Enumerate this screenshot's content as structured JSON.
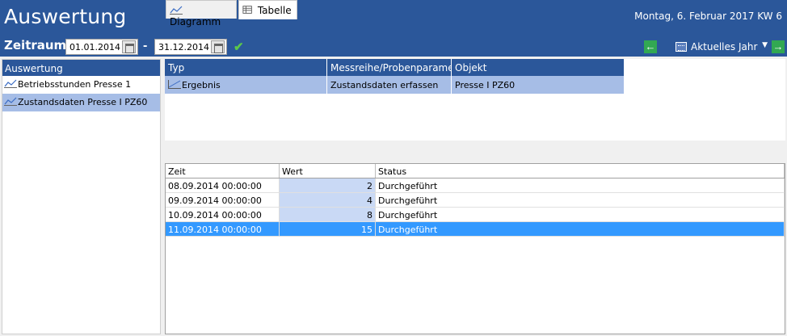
{
  "header": {
    "title": "Auswertung",
    "date_display": "Montag, 6. Februar 2017  KW 6",
    "zeitraum_label": "Zeitraum",
    "date_from": "01.01.2014",
    "date_separator": "-",
    "date_to": "31.12.2014",
    "period_select": "Aktuelles Jahr",
    "prev_icon": "arrow-left-icon",
    "next_icon": "arrow-right-icon",
    "confirm_icon": "checkmark-icon",
    "colors": {
      "primary": "#2b579a",
      "accent_green": "#32a852",
      "selection": "#3399ff",
      "row_highlight": "#a6bde6"
    }
  },
  "sidebar": {
    "header": "Auswertung",
    "items": [
      {
        "label": "Betriebsstunden Presse 1",
        "icon": "line-chart-icon"
      },
      {
        "label": "Zustandsdaten Presse I PZ60",
        "icon": "line-chart-icon"
      }
    ]
  },
  "top_grid": {
    "columns": [
      "Typ",
      "Messreihe/Probenparame...",
      "Objekt"
    ],
    "rows": [
      {
        "typ": "Ergebnis",
        "messreihe": "Zustandsdaten erfassen",
        "objekt": "Presse I PZ60"
      }
    ]
  },
  "tabs": [
    {
      "label": "Diagramm",
      "icon": "line-chart-icon"
    },
    {
      "label": "Tabelle",
      "icon": "table-icon"
    }
  ],
  "bottom_grid": {
    "columns": [
      "Zeit",
      "Wert",
      "Status"
    ],
    "rows": [
      {
        "zeit": "08.09.2014  00:00:00",
        "wert": "2",
        "status": "Durchgeführt"
      },
      {
        "zeit": "09.09.2014  00:00:00",
        "wert": "4",
        "status": "Durchgeführt"
      },
      {
        "zeit": "10.09.2014  00:00:00",
        "wert": "8",
        "status": "Durchgeführt"
      },
      {
        "zeit": "11.09.2014  00:00:00",
        "wert": "15",
        "status": "Durchgeführt"
      }
    ]
  }
}
